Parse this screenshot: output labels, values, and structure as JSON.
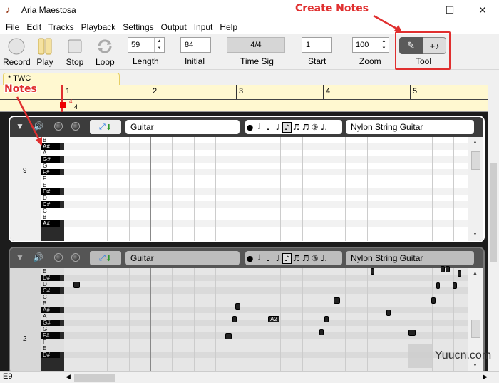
{
  "window": {
    "title": "Aria Maestosa",
    "minimize": "—",
    "maximize": "☐",
    "close": "✕"
  },
  "menu": [
    "File",
    "Edit",
    "Tracks",
    "Playback",
    "Settings",
    "Output",
    "Input",
    "Help"
  ],
  "toolbar": {
    "record": "Record",
    "play": "Play",
    "stop": "Stop",
    "loop": "Loop",
    "length_value": "59",
    "length_label": "Length",
    "initial_value": "84",
    "initial_label": "Initial",
    "timesig_value": "4/4",
    "timesig_label": "Time Sig",
    "start_value": "1",
    "start_label": "Start",
    "zoom_value": "100",
    "zoom_label": "Zoom",
    "tool_label": "Tool"
  },
  "annotations": {
    "create_notes": "Create Notes",
    "notes": "Notes"
  },
  "sequence": {
    "tab_label": "* TWC",
    "measures": [
      "1",
      "2",
      "3",
      "4",
      "5"
    ],
    "ts_num": "4",
    "ts_den": "4"
  },
  "tracks": [
    {
      "instrument": "Guitar",
      "sound": "Nylon String Guitar",
      "octave_label": "9",
      "keys": [
        "B",
        "A#",
        "A",
        "G#",
        "G",
        "F#",
        "F",
        "E",
        "D#",
        "D",
        "C#",
        "C",
        "B",
        "A#"
      ]
    },
    {
      "instrument": "Guitar",
      "sound": "Nylon String Guitar",
      "octave_label": "2",
      "keys": [
        "E",
        "D#",
        "D",
        "C#",
        "C",
        "B",
        "A#",
        "A",
        "G#",
        "G",
        "F#",
        "F",
        "E",
        "D#"
      ],
      "note_labels": [
        "A2"
      ]
    }
  ],
  "status": {
    "text": "E9"
  },
  "watermark": {
    "text": "Yuucn.com"
  },
  "colors": {
    "annotation_red": "#e02f2f",
    "ruler_bg": "#fff8d0",
    "track_dark": "#3c3c3c"
  }
}
